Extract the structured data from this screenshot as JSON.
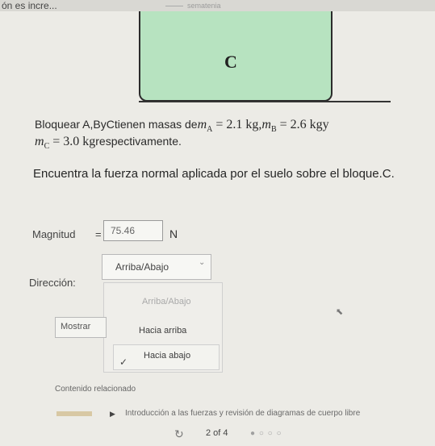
{
  "header": {
    "title": "ón es incre...",
    "faint_text": "sematenia"
  },
  "diagram": {
    "block_label": "C"
  },
  "problem": {
    "line1_text": "Bloquear A,ByCtienen masas de",
    "m_a": "m",
    "sub_a": "A",
    "eq_a": " = 2.1 kg,",
    "m_b": "m",
    "sub_b": "B",
    "eq_b": " = 2.6 kgy",
    "m_c": "m",
    "sub_c": "C",
    "eq_c": " = 3.0 kg",
    "line2_tail": "respectivamente.",
    "question": "Encuentra la fuerza normal aplicada por el suelo sobre el bloque.C."
  },
  "magnitude": {
    "label": "Magnitud",
    "equals": "=",
    "value": "75.46",
    "unit": "N"
  },
  "direction": {
    "label": "Dirección:",
    "selected": "Arriba/Abajo",
    "chevron": "⌄",
    "options": [
      "Arriba/Abajo",
      "Hacia arriba",
      "Hacia abajo"
    ],
    "checked_option": "Hacia abajo",
    "check_mark": "✓"
  },
  "show_button": {
    "label": "Mostrar"
  },
  "related": {
    "heading": "Contenido relacionado",
    "icon": "▶",
    "link": "Introducción a las fuerzas y revisión de diagramas de cuerpo libre"
  },
  "footer": {
    "refresh_icon": "↻",
    "page_indicator": "2 of 4",
    "pager_dots": "● ○ ○ ○"
  }
}
